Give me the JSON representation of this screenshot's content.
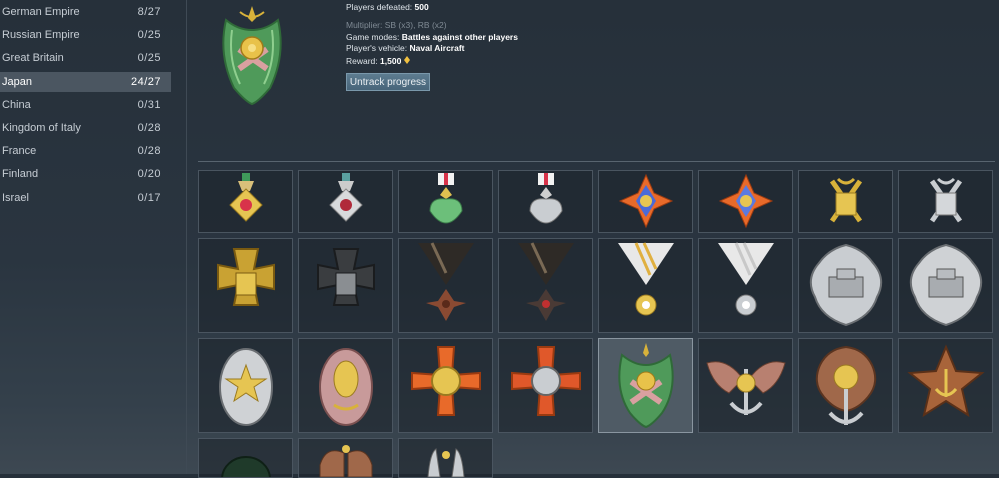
{
  "sidebar": {
    "countries": [
      {
        "name": "German Empire",
        "count": "8/27"
      },
      {
        "name": "Russian Empire",
        "count": "0/25"
      },
      {
        "name": "Great Britain",
        "count": "0/25"
      },
      {
        "name": "Japan",
        "count": "24/27",
        "selected": true
      },
      {
        "name": "China",
        "count": "0/31"
      },
      {
        "name": "Kingdom of Italy",
        "count": "0/28"
      },
      {
        "name": "France",
        "count": "0/28"
      },
      {
        "name": "Finland",
        "count": "0/20"
      },
      {
        "name": "Israel",
        "count": "0/17"
      }
    ]
  },
  "detail": {
    "players_defeated_label": "Players defeated:",
    "players_defeated_value": "500",
    "multiplier": "Multiplier: SB (x3), RB (x2)",
    "game_modes_label": "Game modes:",
    "game_modes_value": "Battles against other players",
    "vehicle_label": "Player's vehicle:",
    "vehicle_value": "Naval Aircraft",
    "reward_label": "Reward:",
    "reward_value": "1,500",
    "reward_icon": "golden-eagle-icon",
    "untrack_button": "Untrack progress"
  },
  "colors": {
    "accent_button": "#4f6e83",
    "selected_row": "#4b5661",
    "gold": "#d8b23a",
    "silver": "#c9cdd1",
    "bronze": "#a06a3e"
  },
  "medals": [
    {
      "name": "order-rising-sun-red-gold",
      "highlight": false
    },
    {
      "name": "order-rising-sun-red-silver",
      "highlight": false
    },
    {
      "name": "paulownia-green-gold",
      "highlight": false
    },
    {
      "name": "paulownia-silver",
      "highlight": false
    },
    {
      "name": "kite-star-orange-blue",
      "highlight": false
    },
    {
      "name": "kite-star-orange-blue-2",
      "highlight": false
    },
    {
      "name": "crossed-swords-gold",
      "highlight": false
    },
    {
      "name": "crossed-swords-silver",
      "highlight": false
    },
    {
      "name": "maltese-cross-gold",
      "highlight": false
    },
    {
      "name": "maltese-cross-dark",
      "highlight": false
    },
    {
      "name": "triangle-ribbon-bronze-cross",
      "highlight": false
    },
    {
      "name": "triangle-ribbon-dark-cross",
      "highlight": false
    },
    {
      "name": "triangle-ribbon-gold-star",
      "highlight": false
    },
    {
      "name": "triangle-ribbon-silver-star",
      "highlight": false
    },
    {
      "name": "cherry-tank-badge-silver",
      "highlight": false
    },
    {
      "name": "cherry-tank-badge-silver-2",
      "highlight": false
    },
    {
      "name": "wreath-star-badge-silver",
      "highlight": false
    },
    {
      "name": "wreath-sun-badge-pink",
      "highlight": false
    },
    {
      "name": "orange-cross-gold-medallion",
      "highlight": false
    },
    {
      "name": "orange-cross-silver-medallion",
      "highlight": false
    },
    {
      "name": "green-wreath-anchor-badge",
      "highlight": true
    },
    {
      "name": "winged-anchor-sakura",
      "highlight": false
    },
    {
      "name": "sakura-anchor-badge",
      "highlight": false
    },
    {
      "name": "star-anchor-bronze",
      "highlight": false
    },
    {
      "name": "dark-green-badge",
      "highlight": false
    },
    {
      "name": "bronze-wing-badge",
      "highlight": false
    },
    {
      "name": "silver-torpedo-badge",
      "highlight": false
    }
  ]
}
